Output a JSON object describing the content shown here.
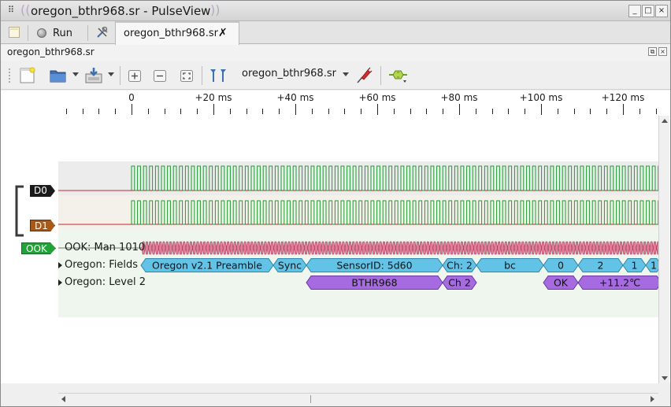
{
  "window": {
    "title": "oregon_bthr968.sr - PulseView",
    "buttons": {
      "minimize": "_",
      "maximize": "□",
      "close": "×"
    }
  },
  "tabs": {
    "run_label": "Run",
    "session_label": "oregon_bthr968.sr"
  },
  "dock": {
    "title": "oregon_bthr968.sr"
  },
  "toolbar": {
    "device_label": "oregon_bthr968.sr",
    "icons": [
      "new-view-icon",
      "open-file-icon",
      "save-icon",
      "zoom-in-icon",
      "zoom-out-icon",
      "zoom-fit-icon",
      "show-cursors-icon",
      "probe-icon",
      "decoder-add-icon"
    ]
  },
  "ruler": {
    "labels": [
      "0",
      "+20 ms",
      "+40 ms",
      "+60 ms",
      "+80 ms",
      "+100 ms",
      "+120 ms"
    ]
  },
  "channels": {
    "d0": {
      "label": "D0",
      "color": "#1a1a1a"
    },
    "d1": {
      "label": "D1",
      "color": "#a7591a"
    },
    "ook": {
      "label": "OOK",
      "color": "#22a33a"
    }
  },
  "decoders": {
    "ook_row_label": "OOK: Man 1010",
    "fields_row_label": "Oregon: Fields",
    "level2_row_label": "Oregon: Level 2",
    "fields_annotations": [
      "Oregon v2.1 Preamble",
      "Sync",
      "SensorID: 5d60",
      "Ch: 2",
      "bc",
      "0",
      "2",
      "1",
      "1"
    ],
    "level2_annotations": [
      "BTHR968",
      "Ch 2",
      "OK",
      "+11.2℃"
    ],
    "colors": {
      "fields": "#63c3e6",
      "level2": "#a66be0",
      "ook": "#e27c98"
    }
  }
}
